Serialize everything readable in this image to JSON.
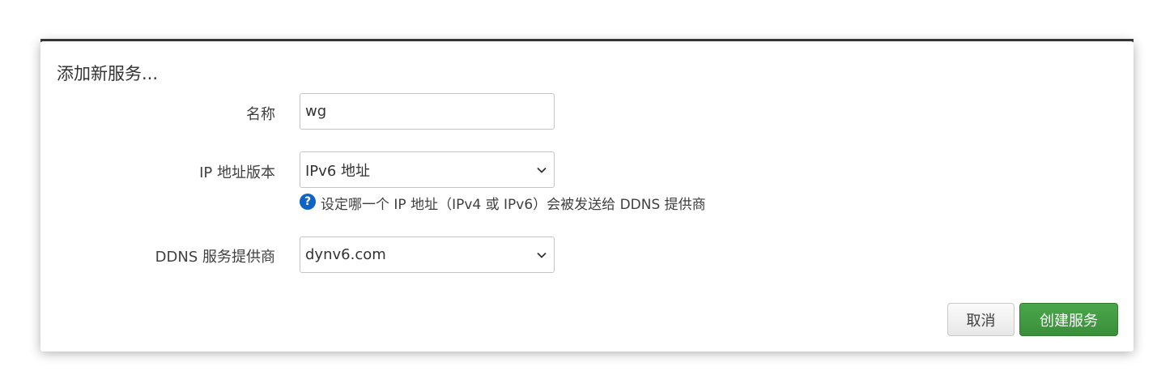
{
  "dialog": {
    "title": "添加新服务...",
    "name_field": {
      "label": "名称",
      "value": "wg"
    },
    "ip_version": {
      "label": "IP 地址版本",
      "selected": "IPv6 地址",
      "hint": "设定哪一个 IP 地址（IPv4 或 IPv6）会被发送给 DDNS 提供商",
      "hint_icon": "question-icon"
    },
    "provider": {
      "label": "DDNS 服务提供商",
      "selected": "dynv6.com"
    },
    "buttons": {
      "cancel": "取消",
      "create": "创建服务"
    }
  },
  "colors": {
    "primary_button": "#3e9a3e",
    "hint_icon": "#0c64c8"
  }
}
